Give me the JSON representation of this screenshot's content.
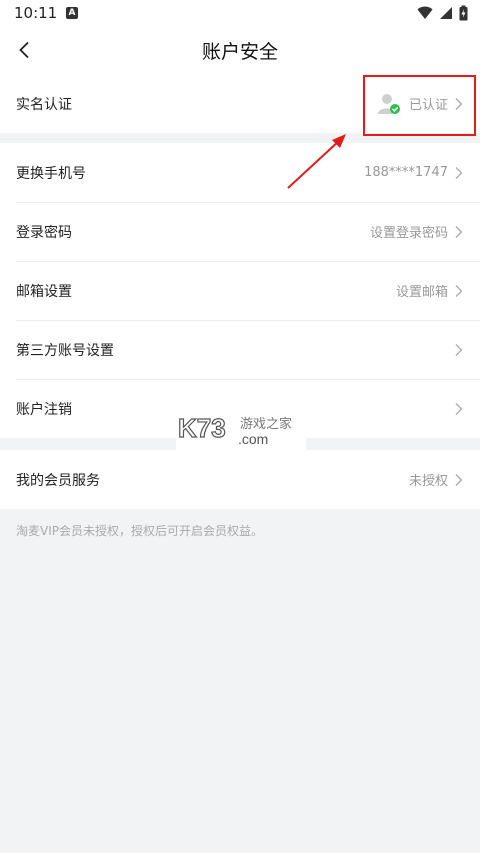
{
  "status_bar": {
    "time": "10:11",
    "notification_badge": "A"
  },
  "nav": {
    "title": "账户安全"
  },
  "section1": {
    "realname": {
      "label": "实名认证",
      "value": "已认证"
    }
  },
  "section2": {
    "items": [
      {
        "label": "更换手机号",
        "value": "188****1747"
      },
      {
        "label": "登录密码",
        "value": "设置登录密码"
      },
      {
        "label": "邮箱设置",
        "value": "设置邮箱"
      },
      {
        "label": "第三方账号设置",
        "value": ""
      },
      {
        "label": "账户注销",
        "value": ""
      }
    ]
  },
  "section3": {
    "membership": {
      "label": "我的会员服务",
      "value": "未授权"
    }
  },
  "footnote": "淘麦VIP会员未授权，授权后可开启会员权益。",
  "watermark": {
    "logo": "K73",
    "text": "游戏之家",
    "domain": ".com"
  },
  "colors": {
    "annotation_red": "#e31b1b",
    "verified_green": "#2fbf4a",
    "background": "#f2f3f5"
  }
}
